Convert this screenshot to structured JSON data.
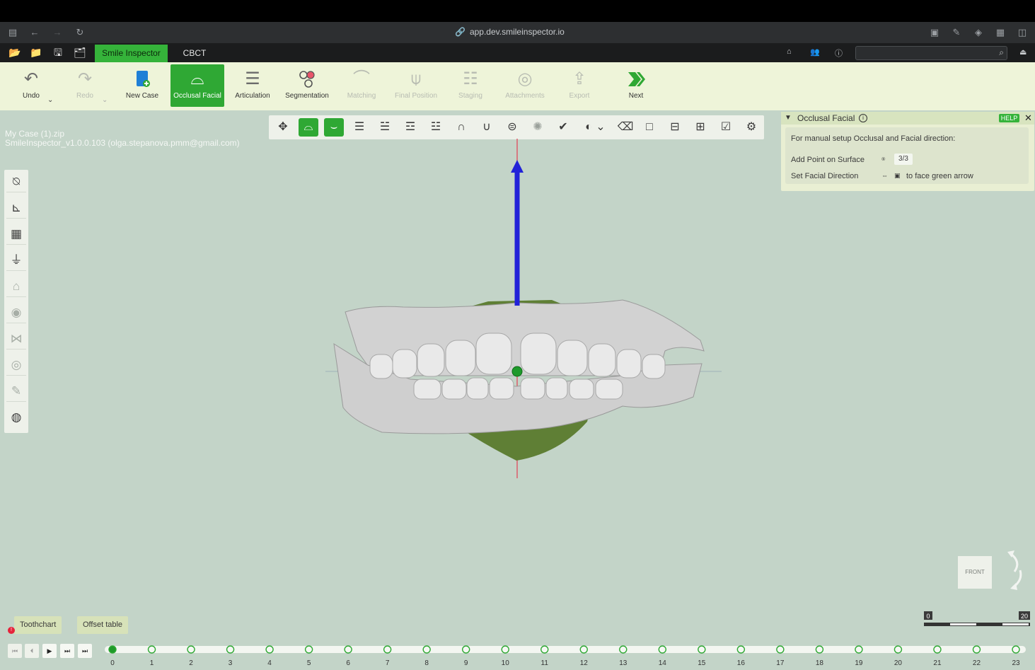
{
  "browser": {
    "url": "app.dev.smileinspector.io"
  },
  "menubar": {
    "tabs": [
      {
        "label": "Smile Inspector"
      },
      {
        "label": "CBCT"
      }
    ],
    "search": {
      "placeholder": ""
    }
  },
  "toolbar": {
    "tools": [
      {
        "label": "Undo"
      },
      {
        "label": "Redo"
      },
      {
        "label": "New Case"
      },
      {
        "label": "Occlusal Facial"
      },
      {
        "label": "Articulation"
      },
      {
        "label": "Segmentation"
      },
      {
        "label": "Matching"
      },
      {
        "label": "Final Position"
      },
      {
        "label": "Staging"
      },
      {
        "label": "Attachments"
      },
      {
        "label": "Export"
      },
      {
        "label": "Next"
      }
    ]
  },
  "case_info": {
    "line1": "My Case (1).zip",
    "line2": "SmileInspector_v1.0.0.103 (olga.stepanova.pmm@gmail.com)"
  },
  "panel": {
    "title": "Occlusal Facial",
    "help_label": "HELP",
    "close_label": "✕",
    "description": "For manual setup Occlusal and Facial direction:",
    "rows": [
      {
        "label": "Add Point on Surface",
        "badge": "3/3"
      },
      {
        "label": "Set Facial Direction",
        "hint": "to face green arrow"
      }
    ]
  },
  "view_cube": {
    "label": "FRONT"
  },
  "bottom": {
    "tabs": [
      {
        "label": "Toothchart"
      },
      {
        "label": "Offset table"
      }
    ],
    "error_badge": "!",
    "timeline": {
      "stages": [
        "0",
        "1",
        "2",
        "3",
        "4",
        "5",
        "6",
        "7",
        "8",
        "9",
        "10",
        "11",
        "12",
        "13",
        "14",
        "15",
        "16",
        "17",
        "18",
        "19",
        "20",
        "21",
        "22",
        "23"
      ],
      "current": 0
    },
    "scale": {
      "min": "0",
      "max": "20"
    }
  },
  "colors": {
    "accent": "#2fa834",
    "viewport": "#c3d4c8",
    "toolbar": "#eef4d9",
    "axis_blue": "#2222d8",
    "axis_red": "#e0495c"
  }
}
